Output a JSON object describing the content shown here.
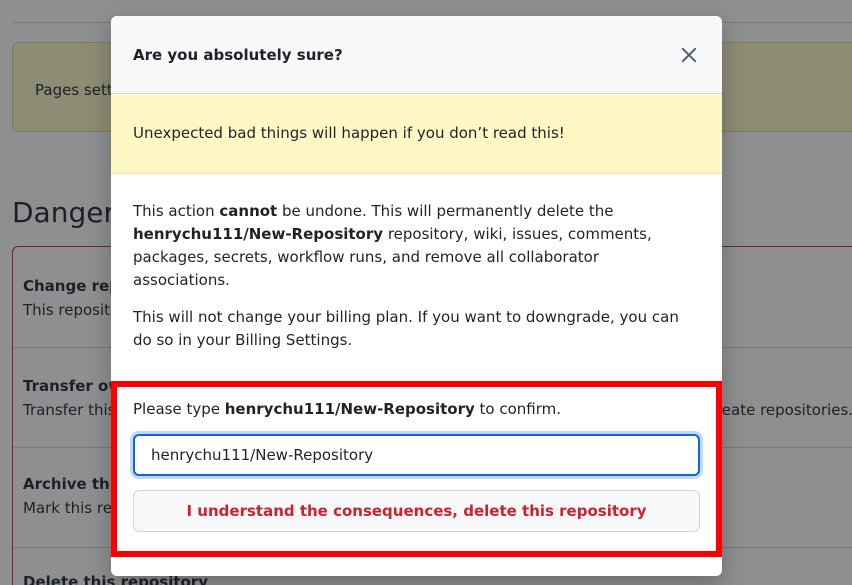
{
  "background": {
    "notice_text": "Pages settings",
    "danger_heading": "Danger Zone",
    "rows": [
      {
        "title": "Change repository visibility",
        "desc": "This repository is currently public."
      },
      {
        "title": "Transfer ownership",
        "desc": "Transfer this repository to another user or to an organization where you have the ability to create repositories."
      },
      {
        "title": "Archive this repository",
        "desc": "Mark this repository as archived and read-only."
      },
      {
        "title": "Delete this repository",
        "desc": ""
      }
    ]
  },
  "modal": {
    "title": "Are you absolutely sure?",
    "close_icon": "close-icon",
    "warning": "Unexpected bad things will happen if you don’t read this!",
    "body": {
      "p1_pre": "This action ",
      "p1_bold": "cannot",
      "p1_mid": " be undone. This will permanently delete the ",
      "repo": "henrychu111/New-Repository",
      "p1_post": " repository, wiki, issues, comments, packages, secrets, workflow runs, and remove all collaborator associations.",
      "p2": "This will not change your billing plan. If you want to downgrade, you can do so in your Billing Settings."
    },
    "confirm": {
      "pre": "Please type ",
      "repo": "henrychu111/New-Repository",
      "post": " to confirm."
    },
    "input_value": "henrychu111/New-Repository",
    "delete_button": "I understand the consequences, delete this repository"
  },
  "colors": {
    "danger": "#cf222e",
    "warning_bg": "#fff8c5",
    "focus": "#0969da",
    "highlight": "#ff0000"
  }
}
